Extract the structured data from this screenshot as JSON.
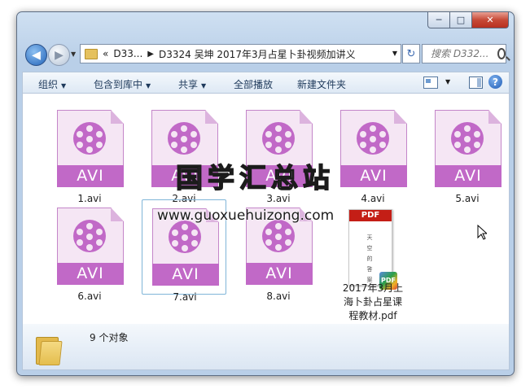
{
  "window": {
    "caption_buttons": [
      "─",
      "□",
      "✕"
    ]
  },
  "nav": {
    "back_glyph": "◀",
    "forward_glyph": "▶",
    "breadcrumb": [
      "D33...",
      "D3324 吴坤 2017年3月占星卜卦视频加讲义"
    ],
    "breadcrumb_prefix": "«",
    "refresh_glyph": "↻",
    "search_placeholder": "搜索 D332..."
  },
  "toolbar": {
    "organize": "组织",
    "include_library": "包含到库中",
    "share": "共享",
    "play_all": "全部播放",
    "new_folder": "新建文件夹",
    "help": "?"
  },
  "files": [
    {
      "name": "1.avi",
      "type": "AVI"
    },
    {
      "name": "2.avi",
      "type": "AVI"
    },
    {
      "name": "3.avi",
      "type": "AVI"
    },
    {
      "name": "4.avi",
      "type": "AVI"
    },
    {
      "name": "5.avi",
      "type": "AVI"
    },
    {
      "name": "6.avi",
      "type": "AVI"
    },
    {
      "name": "7.avi",
      "type": "AVI"
    },
    {
      "name": "8.avi",
      "type": "AVI"
    },
    {
      "name": "2017年3月上海卜卦占星课程教材.pdf",
      "type": "PDF",
      "cover_text": "天空的答案",
      "badge": "PDF"
    }
  ],
  "watermark": {
    "title": "国学汇总站",
    "url": "www.guoxuehuizong.com"
  },
  "status": {
    "count": "9 个对象"
  },
  "colors": {
    "avi_accent": "#c169c7",
    "pdf_red": "#c41e16",
    "selection_border": "#80b5d8"
  }
}
